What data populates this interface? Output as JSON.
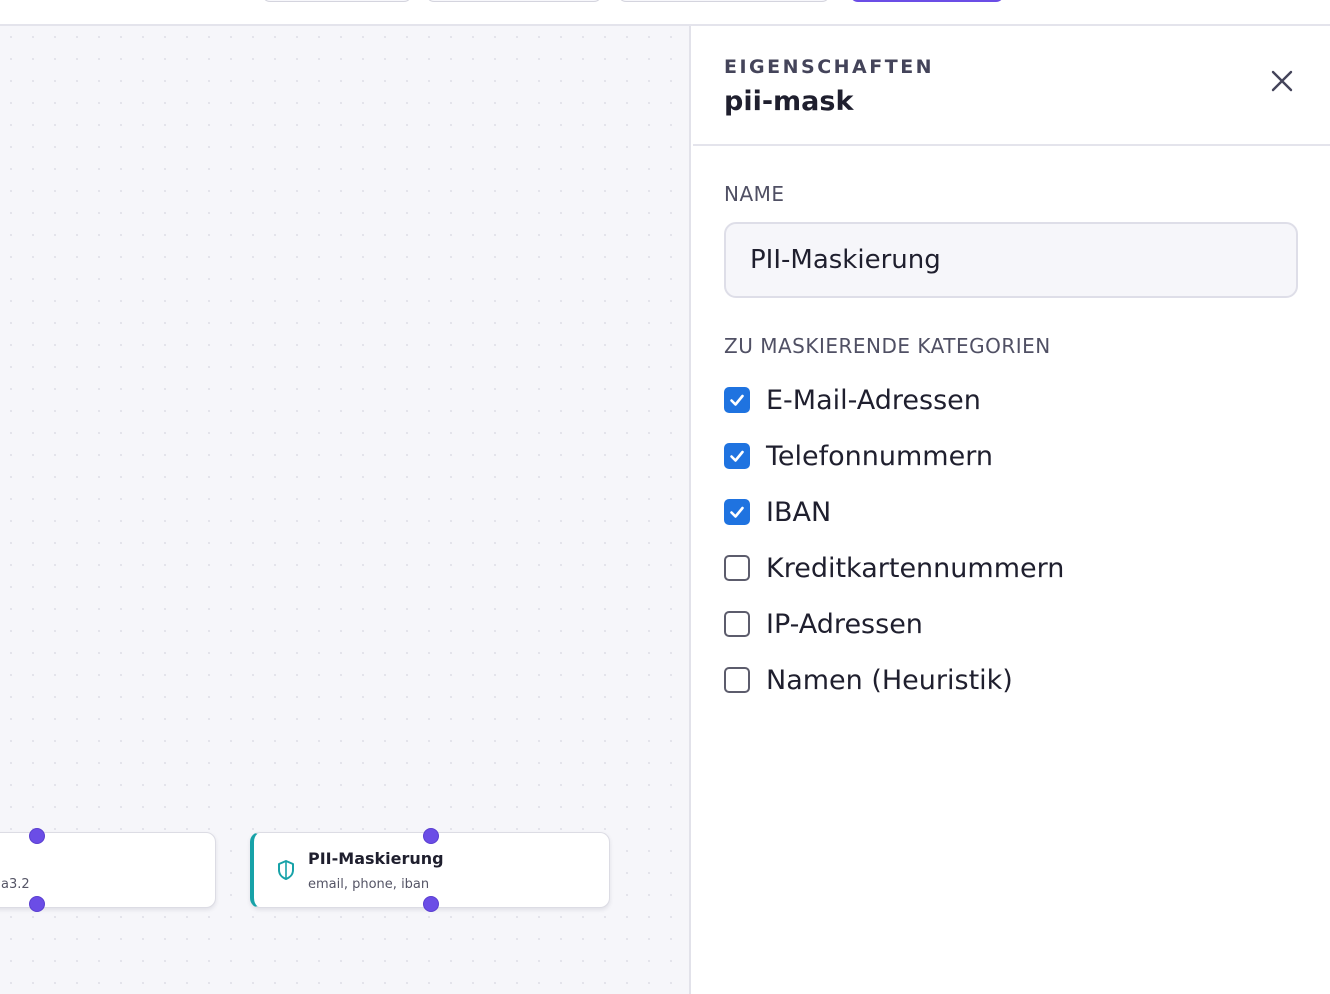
{
  "toolbar": {
    "buttons": [
      "",
      "",
      "",
      ""
    ]
  },
  "canvas": {
    "prev_node": {
      "subtitle": "a3.2"
    },
    "pii_node": {
      "icon": "shield-icon",
      "title": "PII-Maskierung",
      "subtitle": "email, phone, iban"
    }
  },
  "panel": {
    "eyebrow": "EIGENSCHAFTEN",
    "title": "pii-mask",
    "close_icon": "close-icon",
    "name_label": "NAME",
    "name_value": "PII-Maskierung",
    "categories_label": "ZU MASKIERENDE KATEGORIEN",
    "categories": [
      {
        "label": "E-Mail-Adressen",
        "checked": true
      },
      {
        "label": "Telefonnummern",
        "checked": true
      },
      {
        "label": "IBAN",
        "checked": true
      },
      {
        "label": "Kreditkartennummern",
        "checked": false
      },
      {
        "label": "IP-Adressen",
        "checked": false
      },
      {
        "label": "Namen (Heuristik)",
        "checked": false
      }
    ]
  },
  "colors": {
    "accent": "#6b4de6",
    "checkbox": "#1f73e0",
    "node_stripe": "#17a2a8"
  }
}
